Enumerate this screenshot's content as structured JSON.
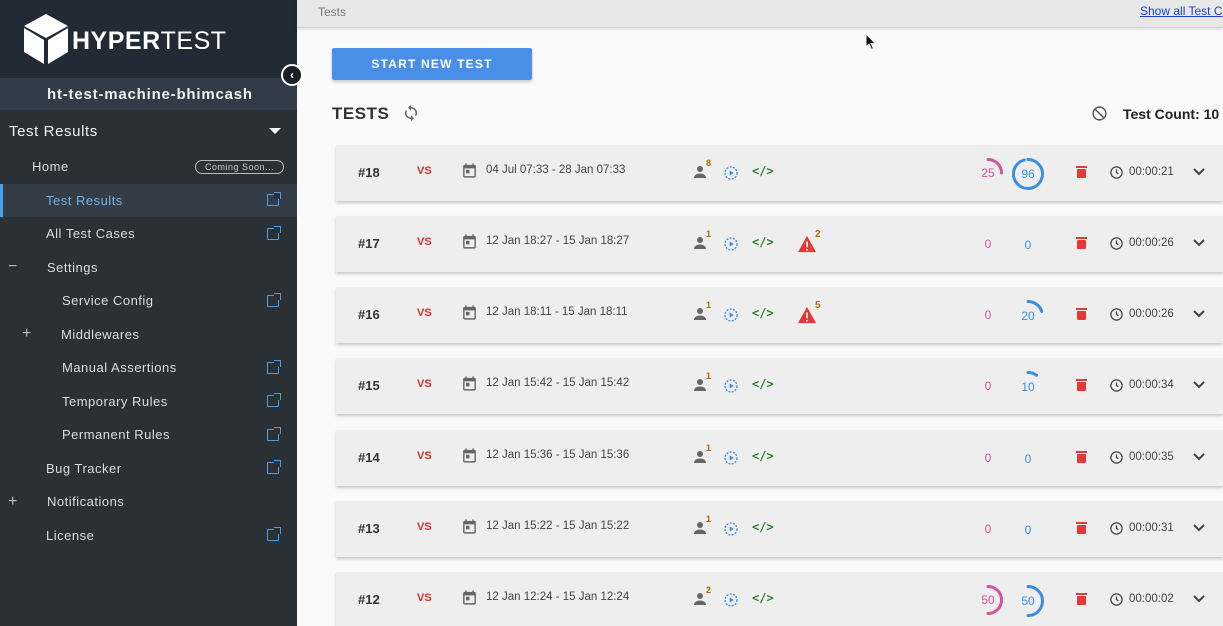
{
  "brand": {
    "logo_text_bold": "HYPER",
    "logo_text_light": "TEST"
  },
  "machine_name": "ht-test-machine-bhimcash",
  "sidebar": {
    "section_title": "Test Results",
    "items": [
      {
        "label": "Home",
        "badge": "Coming Soon..."
      },
      {
        "label": "Test Results"
      },
      {
        "label": "All Test Cases"
      },
      {
        "label": "Settings",
        "prefix": "−"
      },
      {
        "label": "Service Config"
      },
      {
        "label": "Middlewares",
        "prefix": "+"
      },
      {
        "label": "Manual Assertions"
      },
      {
        "label": "Temporary Rules"
      },
      {
        "label": "Permanent Rules"
      },
      {
        "label": "Bug Tracker"
      },
      {
        "label": "Notifications",
        "prefix": "+"
      },
      {
        "label": "License"
      }
    ]
  },
  "topbar": {
    "breadcrumb": "Tests",
    "show_all_link": "Show all Test C"
  },
  "start_button": "START NEW TEST",
  "tests_title": "TESTS",
  "test_count": "Test Count: 10",
  "colors": {
    "accent": "#4a8fe7",
    "pink": "#d6549b",
    "blue": "#3a8ee0",
    "vs": "#d32f2f",
    "code": "#2e7d32",
    "warn": "#e53935",
    "trash": "#e53935"
  },
  "tests": [
    {
      "id": "#18",
      "vs": "VS",
      "range": "04 Jul 07:33 - 28 Jan 07:33",
      "users": "8",
      "warnings": "",
      "g1": "25",
      "g1_frac": 0.25,
      "g2": "96",
      "g2_frac": 0.96,
      "duration": "00:00:21"
    },
    {
      "id": "#17",
      "vs": "VS",
      "range": "12 Jan 18:27 - 15 Jan 18:27",
      "users": "1",
      "warnings": "2",
      "g1": "0",
      "g1_frac": 0,
      "g2": "0",
      "g2_frac": 0,
      "duration": "00:00:26"
    },
    {
      "id": "#16",
      "vs": "VS",
      "range": "12 Jan 18:11 - 15 Jan 18:11",
      "users": "1",
      "warnings": "5",
      "g1": "0",
      "g1_frac": 0,
      "g2": "20",
      "g2_frac": 0.2,
      "duration": "00:00:26"
    },
    {
      "id": "#15",
      "vs": "VS",
      "range": "12 Jan 15:42 - 15 Jan 15:42",
      "users": "1",
      "warnings": "",
      "g1": "0",
      "g1_frac": 0,
      "g2": "10",
      "g2_frac": 0.1,
      "duration": "00:00:34"
    },
    {
      "id": "#14",
      "vs": "VS",
      "range": "12 Jan 15:36 - 15 Jan 15:36",
      "users": "1",
      "warnings": "",
      "g1": "0",
      "g1_frac": 0,
      "g2": "0",
      "g2_frac": 0,
      "duration": "00:00:35"
    },
    {
      "id": "#13",
      "vs": "VS",
      "range": "12 Jan 15:22 - 15 Jan 15:22",
      "users": "1",
      "warnings": "",
      "g1": "0",
      "g1_frac": 0,
      "g2": "0",
      "g2_frac": 0,
      "duration": "00:00:31"
    },
    {
      "id": "#12",
      "vs": "VS",
      "range": "12 Jan 12:24 - 15 Jan 12:24",
      "users": "2",
      "warnings": "",
      "g1": "50",
      "g1_frac": 0.5,
      "g2": "50",
      "g2_frac": 0.5,
      "duration": "00:00:02"
    }
  ]
}
